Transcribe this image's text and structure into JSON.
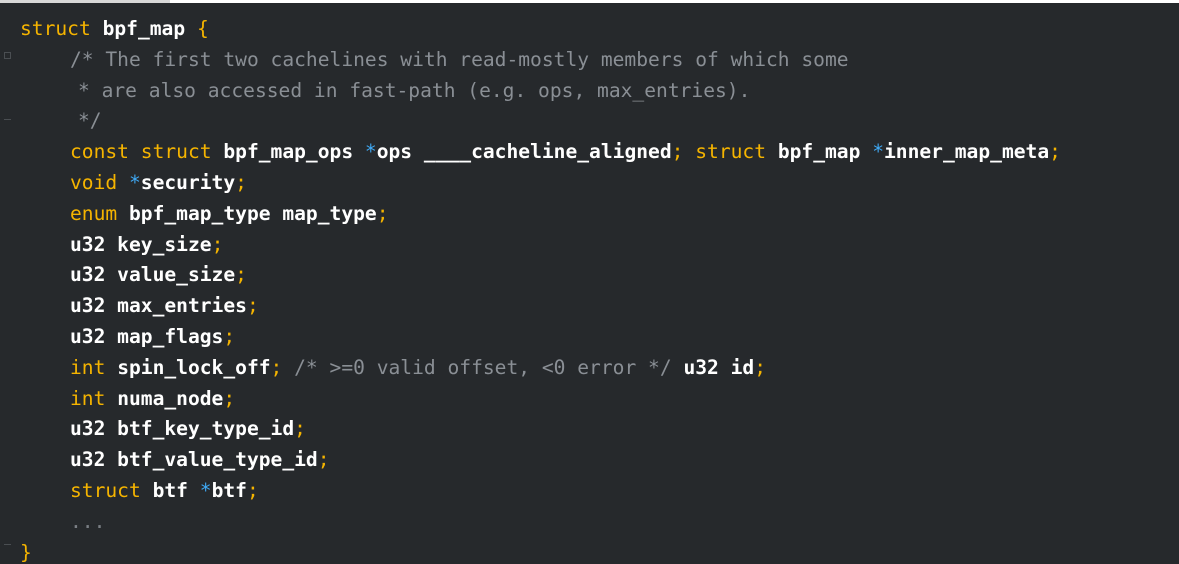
{
  "code": {
    "l1": {
      "kw": "struct",
      "name": "bpf_map",
      "brace": "{"
    },
    "c1": "/* The first two cachelines with read-mostly members of which some",
    "c2": "* are also accessed in fast-path (e.g. ops, max_entries).",
    "c3": "*/",
    "l5": {
      "kw1": "const",
      "kw2": "struct",
      "type": "bpf_map_ops",
      "star": "*",
      "name": "ops ____cacheline_aligned",
      "semi": ";",
      "kw3": "struct",
      "type2": "bpf_map",
      "star2": "*",
      "name2": "inner_map_meta",
      "semi2": ";"
    },
    "l6": {
      "kw": "void",
      "star": "*",
      "name": "security",
      "semi": ";"
    },
    "l7": {
      "kw": "enum",
      "name": "bpf_map_type map_type",
      "semi": ";"
    },
    "l8": {
      "name": "u32 key_size",
      "semi": ";"
    },
    "l9": {
      "name": "u32 value_size",
      "semi": ";"
    },
    "l10": {
      "name": "u32 max_entries",
      "semi": ";"
    },
    "l11": {
      "name": "u32 map_flags",
      "semi": ";"
    },
    "l12": {
      "kw": "int",
      "name": "spin_lock_off",
      "semi": ";",
      "comment": "/* >=0 valid offset, <0 error */",
      "name2": "u32 id",
      "semi2": ";"
    },
    "l13": {
      "kw": "int",
      "name": "numa_node",
      "semi": ";"
    },
    "l14": {
      "name": "u32 btf_key_type_id",
      "semi": ";"
    },
    "l15": {
      "name": "u32 btf_value_type_id",
      "semi": ";"
    },
    "l16": {
      "kw": "struct",
      "name": "btf",
      "star": "*",
      "name2": "btf",
      "semi": ";"
    },
    "l17": "...",
    "l18": "}"
  },
  "colors": {
    "background": "#26292c",
    "keyword": "#f5b400",
    "identifier": "#ffffff",
    "pointer": "#3fa9f5",
    "comment": "#8a8f95"
  }
}
